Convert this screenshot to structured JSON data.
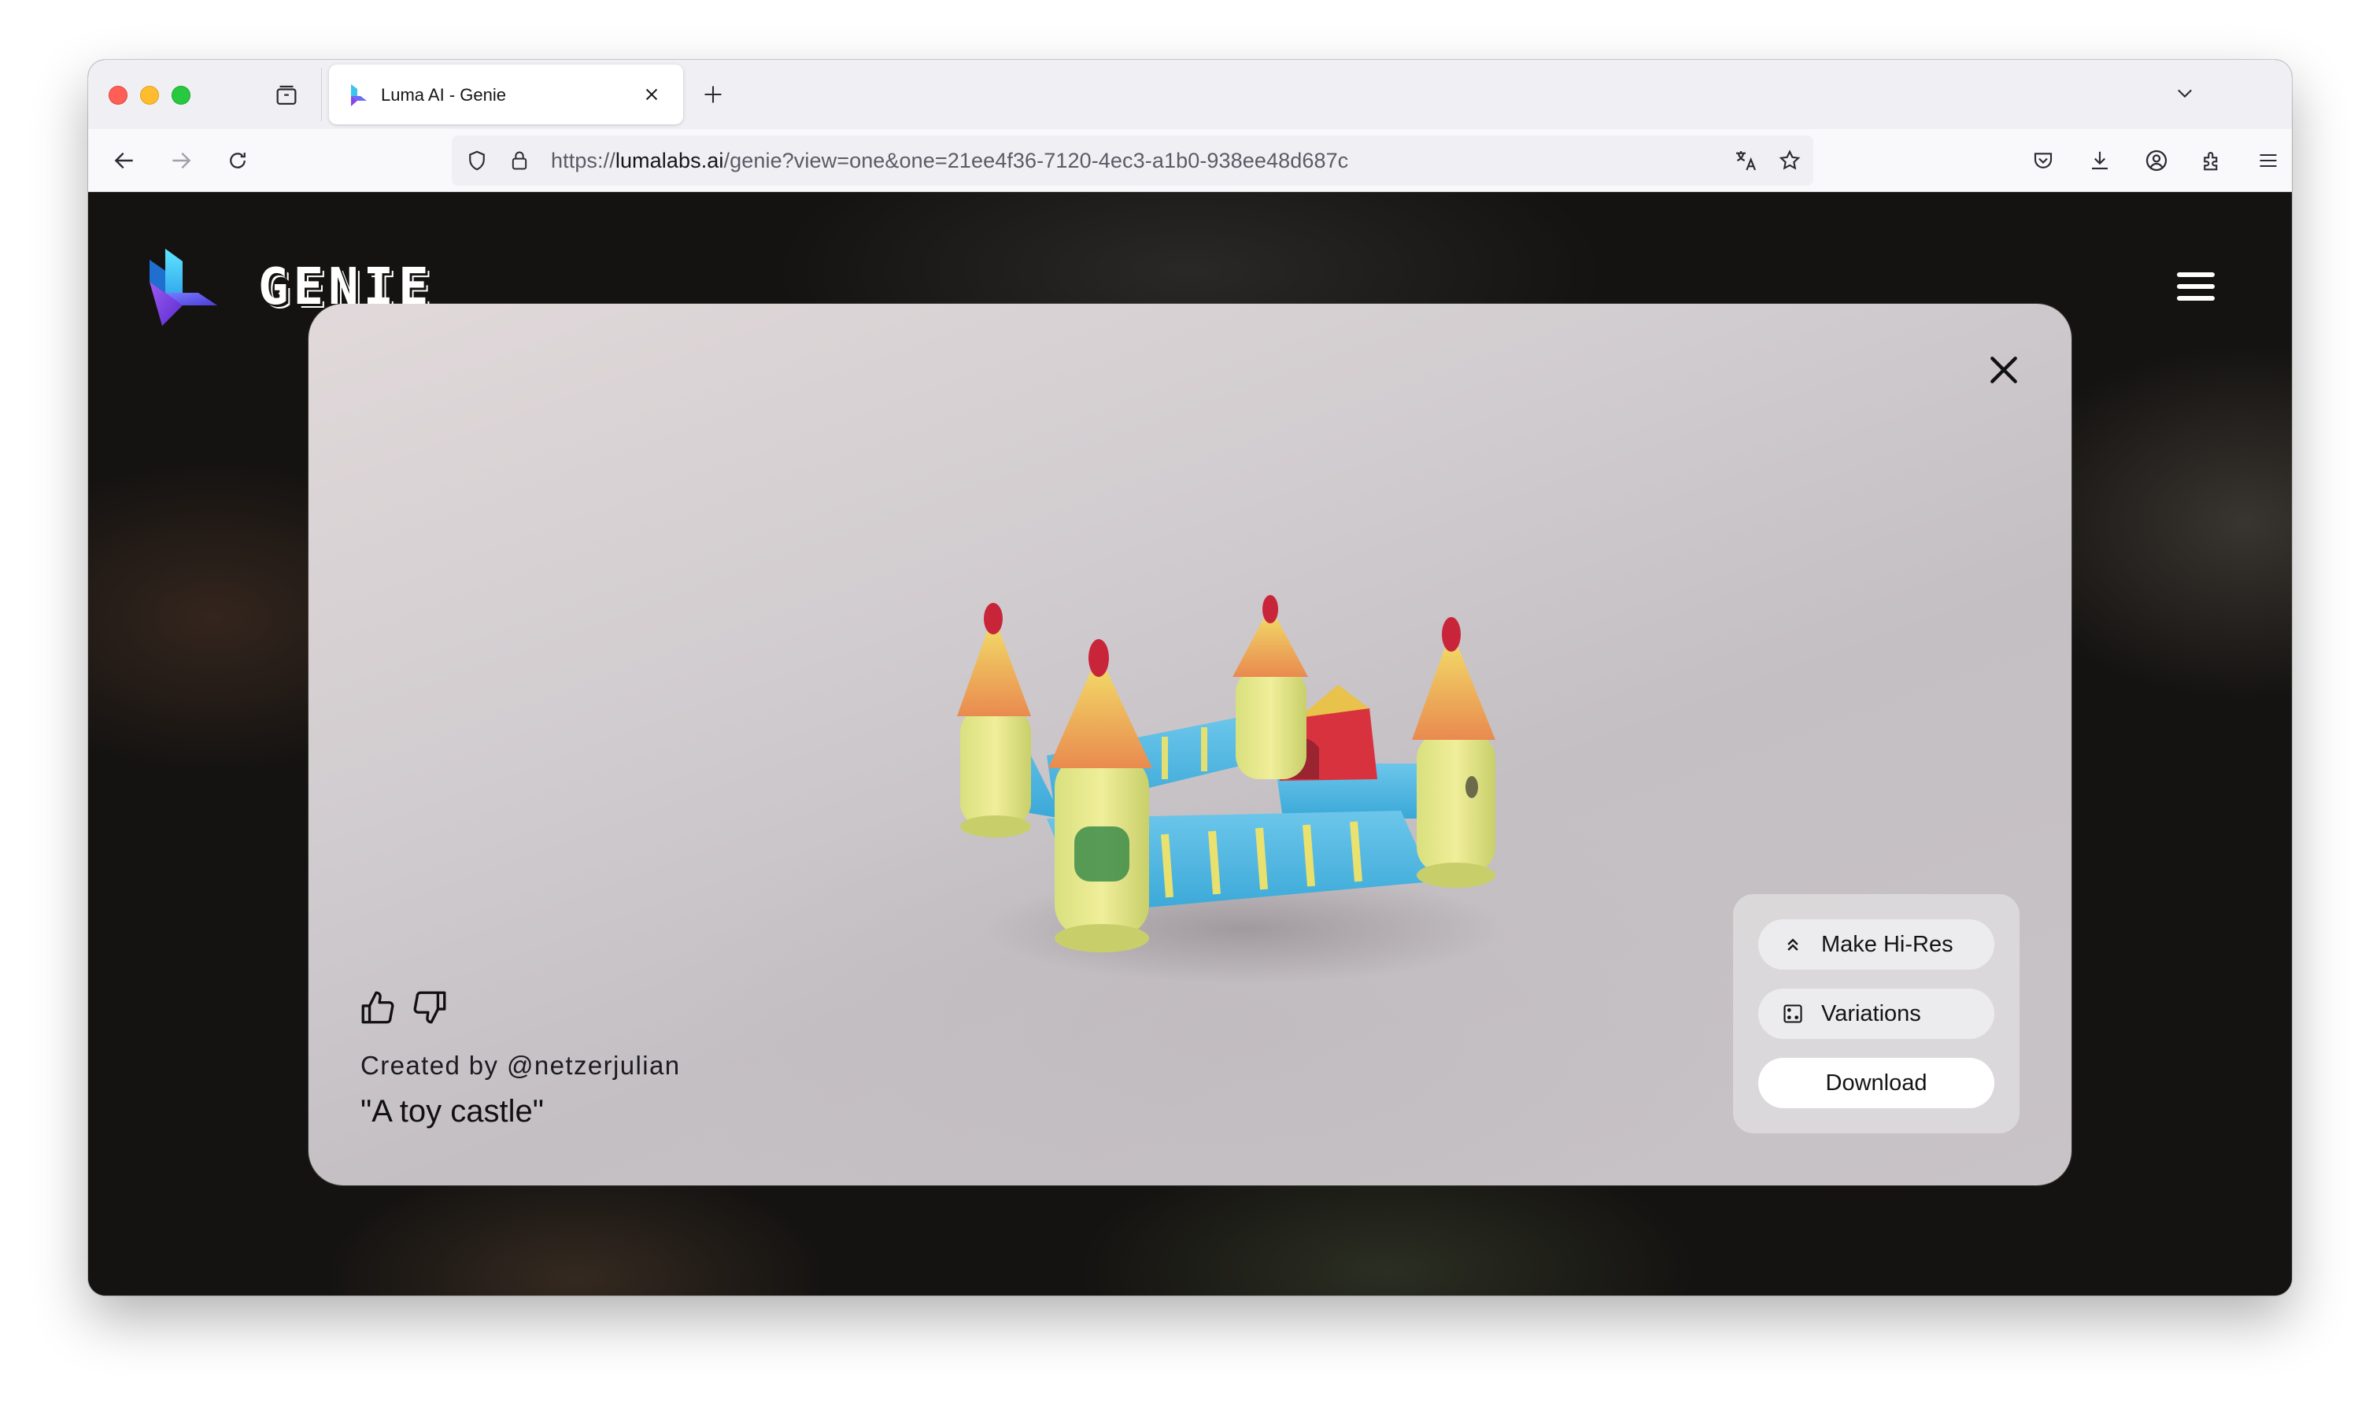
{
  "browser": {
    "tab": {
      "title": "Luma AI - Genie"
    },
    "url": {
      "scheme": "https://",
      "host": "lumalabs.ai",
      "path": "/genie?view=one&one=21ee4f36-7120-4ec3-a1b0-938ee48d687c"
    },
    "icons": [
      "tab-overview-icon",
      "close-icon",
      "plus-icon",
      "chevron-down-icon",
      "back-arrow-icon",
      "forward-arrow-icon",
      "reload-icon",
      "shield-icon",
      "lock-icon",
      "translate-icon",
      "star-icon",
      "pocket-icon",
      "download-icon",
      "account-icon",
      "extensions-icon",
      "menu-icon"
    ]
  },
  "site": {
    "logo_text": "GENIE",
    "icons": [
      "luma-logo-icon",
      "hamburger-menu-icon"
    ]
  },
  "modal": {
    "created_by": "Created by @netzerjulian",
    "prompt": "\"A toy castle\"",
    "actions": {
      "make_hires": "Make Hi-Res",
      "variations": "Variations",
      "download": "Download"
    },
    "icons": [
      "close-icon",
      "thumbs-up-icon",
      "thumbs-down-icon",
      "chevrons-up-icon",
      "dice-icon"
    ]
  }
}
